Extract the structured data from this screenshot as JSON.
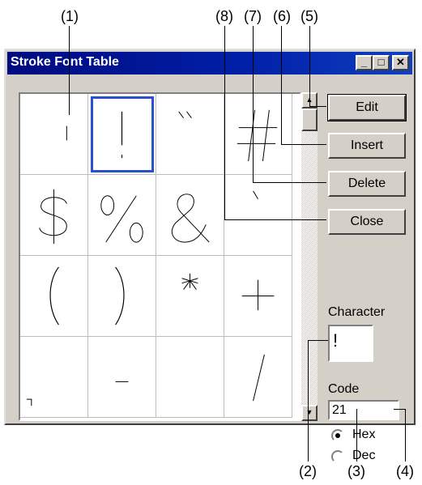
{
  "callouts": {
    "c1": "(1)",
    "c2": "(2)",
    "c3": "(3)",
    "c4": "(4)",
    "c5": "(5)",
    "c6": "(6)",
    "c7": "(7)",
    "c8": "(8)"
  },
  "window": {
    "title": "Stroke Font Table",
    "minimize": "_",
    "maximize": "□",
    "close": "✕"
  },
  "grid": {
    "cells": [
      " ",
      "!",
      "\"",
      "#",
      "$",
      "%",
      "&",
      "'",
      "(",
      ")",
      "*",
      "+",
      ",",
      "-",
      ".",
      "/"
    ],
    "selected_index": 1
  },
  "buttons": {
    "edit": "Edit",
    "insert": "Insert",
    "delete": "Delete",
    "close": "Close"
  },
  "character": {
    "label": "Character",
    "value": "!"
  },
  "code": {
    "label": "Code",
    "value": "21",
    "hex_label": "Hex",
    "dec_label": "Dec",
    "selected": "Hex"
  },
  "icons": {
    "scroll_up": "scroll-up-arrow-icon",
    "scroll_down": "scroll-down-arrow-icon"
  }
}
